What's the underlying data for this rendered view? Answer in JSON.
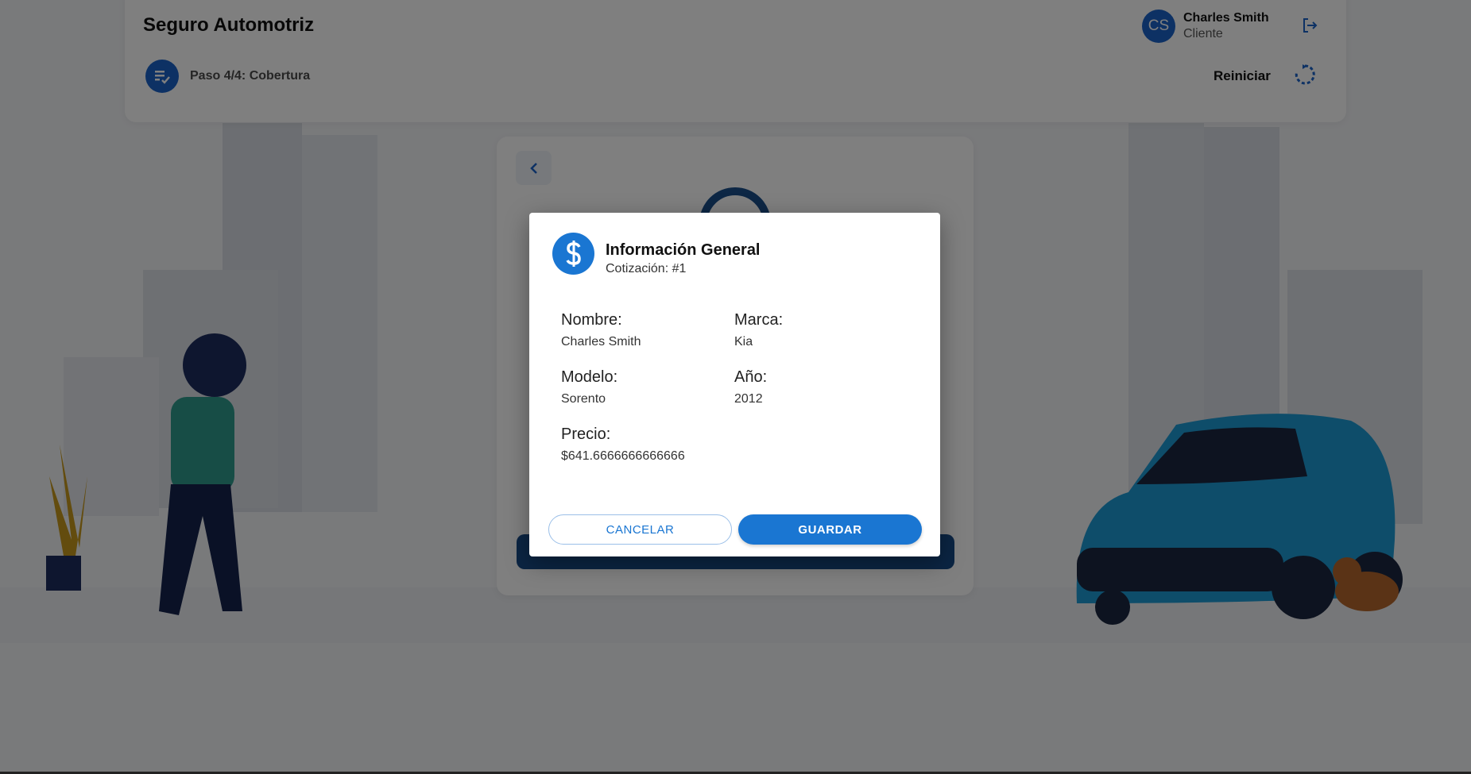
{
  "header": {
    "title": "Seguro Automotriz",
    "step_label": "Paso 4/4: Cobertura",
    "user": {
      "initials": "CS",
      "name": "Charles Smith",
      "role": "Cliente"
    },
    "restart_label": "Reiniciar"
  },
  "modal": {
    "title": "Información General",
    "subtitle": "Cotización: #1",
    "fields": {
      "nombre": {
        "label": "Nombre:",
        "value": "Charles Smith"
      },
      "marca": {
        "label": "Marca:",
        "value": "Kia"
      },
      "modelo": {
        "label": "Modelo:",
        "value": "Sorento"
      },
      "anio": {
        "label": "Año:",
        "value": "2012"
      },
      "precio": {
        "label": "Precio:",
        "value": "$641.6666666666666"
      }
    },
    "cancel_label": "CANCELAR",
    "save_label": "GUARDAR"
  },
  "colors": {
    "primary": "#1a76d2",
    "dark_primary": "#1a63c9",
    "overlay": "rgba(0,0,0,0.5)"
  },
  "icons": {
    "step": "checklist-icon",
    "logout": "logout-icon",
    "restart": "restart-icon",
    "back": "chevron-left-icon",
    "modal": "dollar-icon"
  }
}
